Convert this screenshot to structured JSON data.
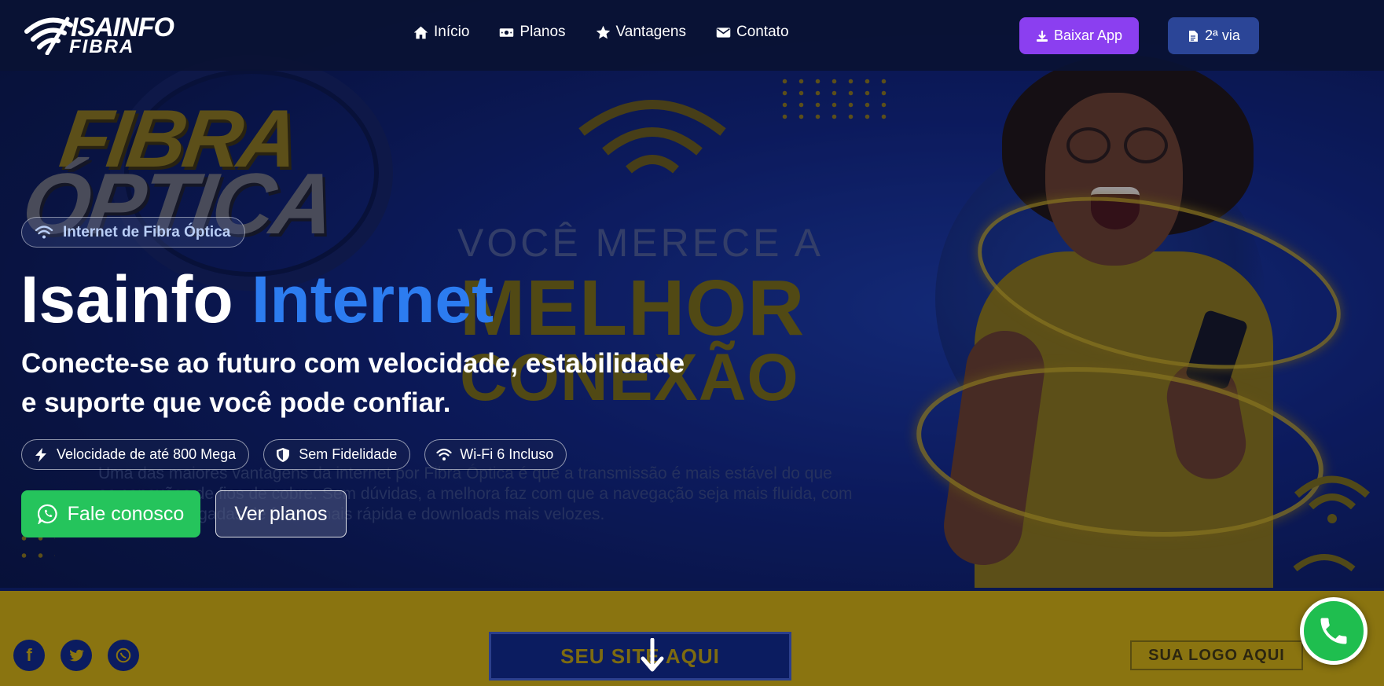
{
  "brand": {
    "logo_top": "ISAINFO",
    "logo_bottom": "FIBRA"
  },
  "nav": {
    "items": [
      {
        "label": "Início",
        "icon": "home-icon"
      },
      {
        "label": "Planos",
        "icon": "money-icon"
      },
      {
        "label": "Vantagens",
        "icon": "star-icon"
      },
      {
        "label": "Contato",
        "icon": "envelope-icon"
      }
    ],
    "app_button": "Baixar App",
    "via_button": "2ª via"
  },
  "hero": {
    "badge": "Internet de Fibra Óptica",
    "title_main": "Isainfo",
    "title_accent": "Internet",
    "subtitle": "Conecte-se ao futuro com velocidade, estabilidade e suporte que você pode confiar.",
    "features": [
      {
        "label": "Velocidade de até 800 Mega",
        "icon": "bolt-icon"
      },
      {
        "label": "Sem Fidelidade",
        "icon": "shield-icon"
      },
      {
        "label": "Wi-Fi 6 Incluso",
        "icon": "wifi-icon"
      }
    ],
    "cta_primary": "Fale conosco",
    "cta_secondary": "Ver planos"
  },
  "banner": {
    "fibra": "FIBRA",
    "optica": "ÓPTICA",
    "merece": "VOCÊ MERECE A",
    "melhor": "MELHOR",
    "conexao": "CONEXÃO",
    "paragraph": "Uma das maiores vantagens da internet por Fibra Óptica é que a transmissão é mais estável do que as conexões de fios de cobre. Sem dúvidas, a melhora faz com que a navegação seja mais fluida, com páginas carregadas de forma mais rápida e downloads mais velozes.",
    "site": "SEU SITE AQUI",
    "logo": "SUA LOGO AQUI"
  },
  "colors": {
    "accent_blue": "#2c7cf0",
    "app_purple": "#8b3ff0",
    "via_blue": "#2b4597",
    "whatsapp_green": "#25c45c"
  }
}
